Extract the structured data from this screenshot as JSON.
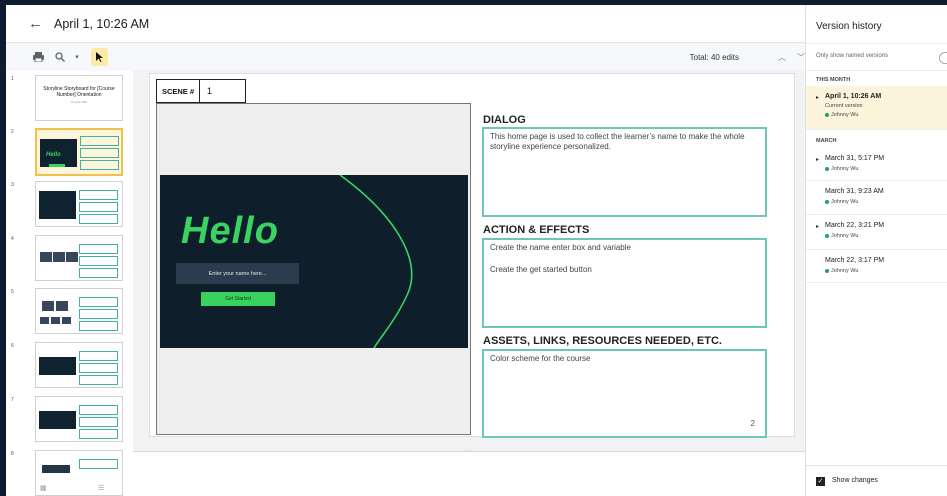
{
  "header": {
    "back_icon": "arrow-left-icon",
    "title": "April 1, 10:26 AM"
  },
  "toolbar": {
    "print_icon": "print-icon",
    "zoom_icon": "zoom-icon",
    "zoom_dropdown_icon": "caret-down-icon",
    "cursor_icon": "select-cursor-icon",
    "edits_label": "Total: 40 edits",
    "prev_icon": "chevron-up-icon",
    "next_icon": "chevron-down-icon"
  },
  "rail": {
    "slides": [
      {
        "num": "1",
        "title": "Storyline Storyboard for [Course Number] Orientation",
        "sub": "Course Title"
      },
      {
        "num": "2"
      },
      {
        "num": "3"
      },
      {
        "num": "4"
      },
      {
        "num": "5"
      },
      {
        "num": "6"
      },
      {
        "num": "7"
      },
      {
        "num": "8"
      }
    ]
  },
  "slide": {
    "scene_label": "SCENE #",
    "scene_number": "1",
    "preview": {
      "hello": "Hello",
      "input_placeholder": "Enter your name here...",
      "button_label": "Get Started"
    },
    "dialog": {
      "title": "DIALOG",
      "text": "This home page is used to collect the learner’s name to make the whole storyline experience personalized."
    },
    "actions": {
      "title": "ACTION & EFFECTS",
      "lines": [
        "Create the name enter box and variable",
        "Create the get started button"
      ]
    },
    "assets": {
      "title": "ASSETS, LINKS, RESOURCES NEEDED, ETC.",
      "text": "Color scheme for the course",
      "page_number": "2"
    }
  },
  "version_history": {
    "title": "Version history",
    "filter_label": "Only show named versions",
    "sections": {
      "this_month": "THIS MONTH",
      "march": "MARCH"
    },
    "current": {
      "date": "April 1, 10:26 AM",
      "sub": "Current version",
      "user": "Johnny Wu"
    },
    "versions": [
      {
        "date": "March 31, 5:17 PM",
        "user": "Johnny Wu",
        "expandable": true
      },
      {
        "date": "March 31, 9:23 AM",
        "user": "Johnny Wu",
        "expandable": false
      },
      {
        "date": "March 22, 3:21 PM",
        "user": "Johnny Wu",
        "expandable": true
      },
      {
        "date": "March 22, 3:17 PM",
        "user": "Johnny Wu",
        "expandable": false
      }
    ],
    "show_changes_label": "Show changes",
    "show_changes_checked": true
  },
  "colors": {
    "accent_green": "#3ad361",
    "teal_border": "#6fc6b6",
    "preview_bg": "#0e1f2b",
    "current_version_bg": "#fdf4dc"
  }
}
